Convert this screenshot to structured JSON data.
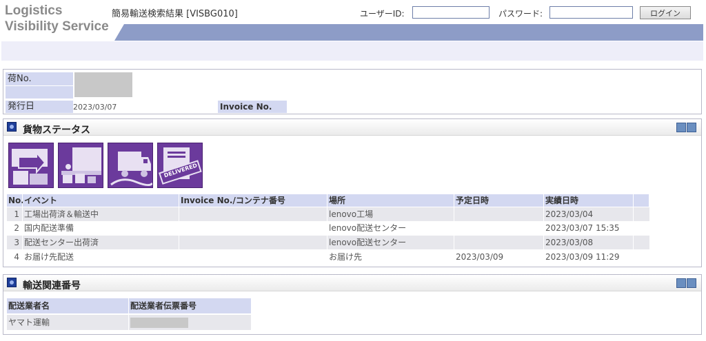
{
  "brand": {
    "line1": "Logistics",
    "line2": "Visibility Service"
  },
  "page_title": "簡易輸送検索結果 [VISBG010]",
  "login": {
    "user_id_label": "ユーザーID:",
    "password_label": "パスワード:",
    "button_label": "ログイン",
    "user_id_value": "",
    "password_value": ""
  },
  "shipment": {
    "cargo_no_label": "荷No.",
    "issue_date_label": "発行日",
    "issue_date_value": "2023/03/07",
    "invoice_no_label": "Invoice No.",
    "invoice_no_value": ""
  },
  "cargo_status": {
    "title": "貨物ステータス",
    "icons": [
      "factory-shipping-icon",
      "domestic-delivery-prep-icon",
      "delivery-truck-icon",
      "delivered-icon"
    ],
    "delivered_stamp": "DELIVERED",
    "columns": {
      "no": "No.",
      "event": "イベント",
      "invoice": "Invoice No./コンテナ番号",
      "location": "場所",
      "scheduled": "予定日時",
      "actual": "実績日時"
    },
    "rows": [
      {
        "no": "1",
        "event": "工場出荷済＆輸送中",
        "invoice": "",
        "location": "lenovo工場",
        "scheduled": "",
        "actual": "2023/03/04"
      },
      {
        "no": "2",
        "event": "国内配送準備",
        "invoice": "",
        "location": "lenovo配送センター",
        "scheduled": "",
        "actual": "2023/03/07 15:35"
      },
      {
        "no": "3",
        "event": "配送センター出荷済",
        "invoice": "",
        "location": "lenovo配送センター",
        "scheduled": "",
        "actual": "2023/03/08"
      },
      {
        "no": "4",
        "event": "お届け先配送",
        "invoice": "",
        "location": "お届け先",
        "scheduled": "2023/03/09",
        "actual": "2023/03/09 11:29"
      }
    ]
  },
  "transport": {
    "title": "輸送関連番号",
    "columns": {
      "carrier": "配送業者名",
      "slip": "配送業者伝票番号"
    },
    "rows": [
      {
        "carrier": "ヤマト運輸",
        "slip": ""
      }
    ]
  },
  "colors": {
    "label_bg": "#d3d8f1",
    "header_band": "#8d9cc7",
    "status_icon": "#6b3a9c",
    "section_icon": "#1f3f99"
  }
}
